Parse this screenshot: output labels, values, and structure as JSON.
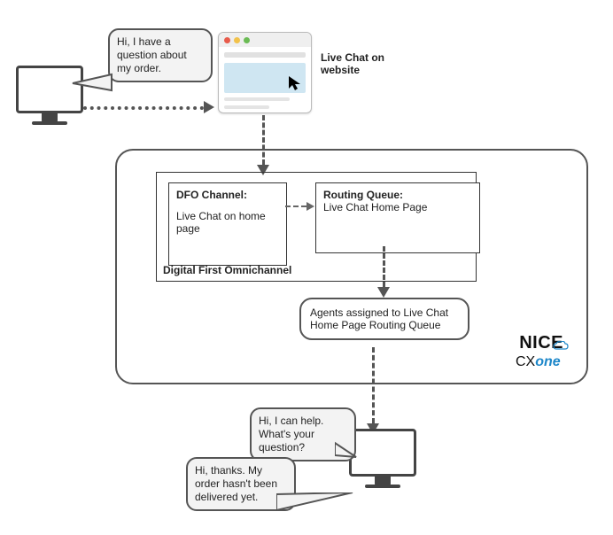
{
  "colors": {
    "accent": "#1d87c9",
    "bubbleFill": "#f3f3f3",
    "browserHero": "#cfe6f2",
    "monitorStroke": "#444444"
  },
  "customer_monitor": {
    "icon": "monitor-icon"
  },
  "customer_bubble": {
    "text": "Hi, I have a question about my order."
  },
  "browser_window": {
    "label": "Live Chat on website"
  },
  "platform": {
    "dfo": {
      "channel": {
        "title": "DFO Channel:",
        "body": "Live Chat on home page"
      },
      "queue": {
        "title": "Routing Queue:",
        "body": "Live Chat Home Page"
      },
      "label": "Digital First Omnichannel"
    },
    "agents": {
      "text": "Agents assigned to Live Chat Home Page Routing Queue"
    },
    "logo": {
      "nice": "NICE",
      "cx": "CX",
      "one": "one"
    }
  },
  "agent_bubble": {
    "text": "Hi, I can help. What's your question?"
  },
  "customer_reply": {
    "text": "Hi, thanks. My order hasn't been delivered yet."
  }
}
